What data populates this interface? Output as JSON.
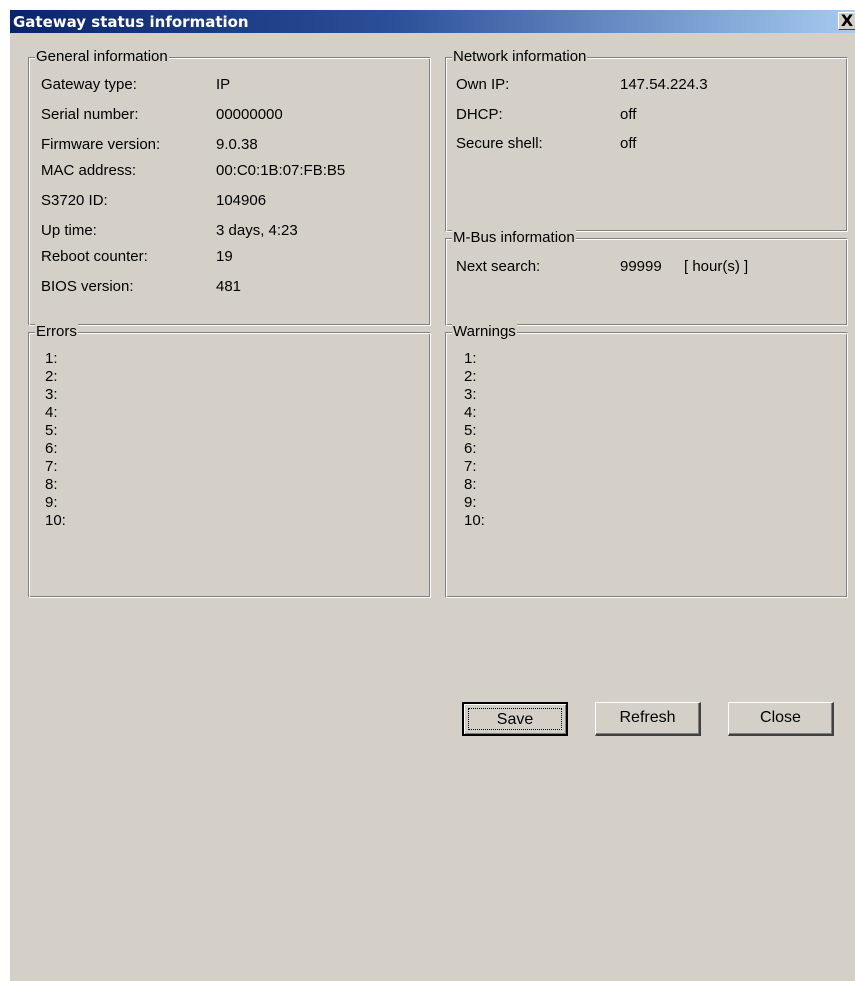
{
  "window": {
    "title": "Gateway status information",
    "close_glyph": "X"
  },
  "general": {
    "legend": "General information",
    "rows": [
      {
        "label": "Gateway type:",
        "value": "IP"
      },
      {
        "label": "Serial number:",
        "value": "00000000"
      },
      {
        "label": "Firmware version:",
        "value": "9.0.38"
      },
      {
        "label": "MAC address:",
        "value": "00:C0:1B:07:FB:B5"
      },
      {
        "label": "S3720 ID:",
        "value": "104906"
      },
      {
        "label": "Up time:",
        "value": "3 days, 4:23"
      },
      {
        "label": "Reboot counter:",
        "value": "19"
      },
      {
        "label": "BIOS version:",
        "value": "481"
      }
    ]
  },
  "network": {
    "legend": "Network information",
    "rows": [
      {
        "label": "Own IP:",
        "value": "147.54.224.3"
      },
      {
        "label": "DHCP:",
        "value": "off"
      },
      {
        "label": "Secure shell:",
        "value": "off"
      }
    ]
  },
  "mbus": {
    "legend": "M-Bus information",
    "label": "Next search:",
    "value": "99999",
    "unit": "[ hour(s) ]"
  },
  "errors": {
    "legend": "Errors",
    "items": [
      "1:",
      "2:",
      "3:",
      "4:",
      "5:",
      "6:",
      "7:",
      "8:",
      "9:",
      "10:"
    ]
  },
  "warnings": {
    "legend": "Warnings",
    "items": [
      "1:",
      "2:",
      "3:",
      "4:",
      "5:",
      "6:",
      "7:",
      "8:",
      "9:",
      "10:"
    ]
  },
  "buttons": {
    "save": "Save",
    "refresh": "Refresh",
    "close": "Close"
  }
}
